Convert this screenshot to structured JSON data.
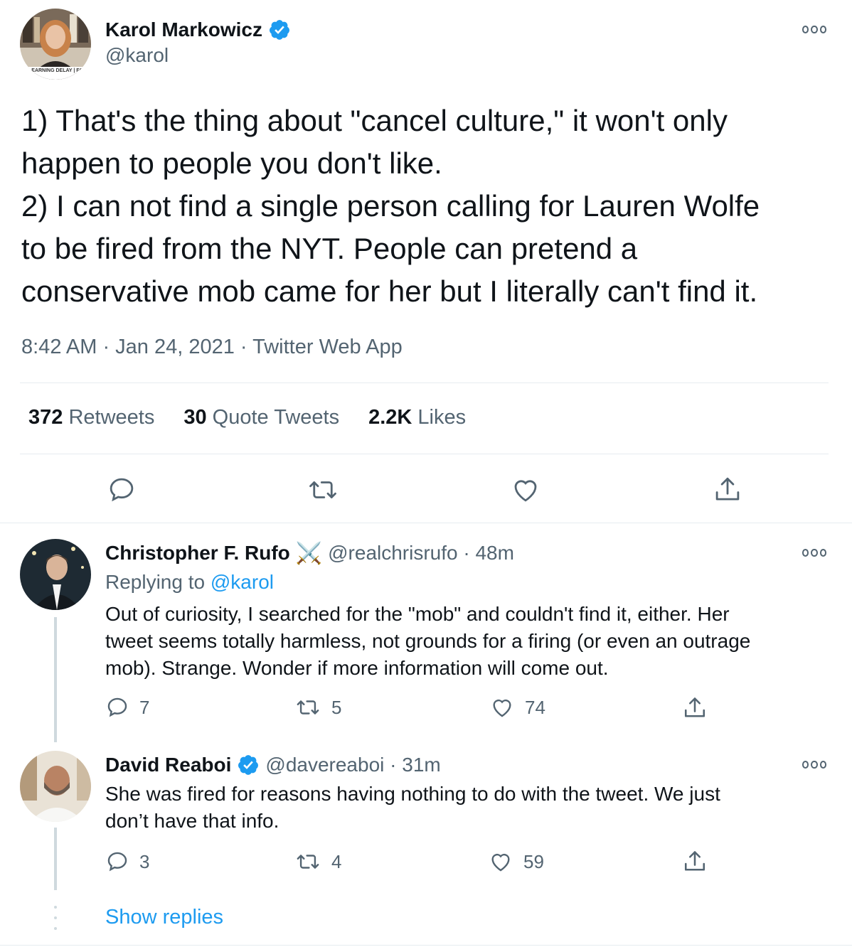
{
  "main_tweet": {
    "author_name": "Karol Markowicz",
    "handle": "@karol",
    "avatar_caption": "LEARNING DELAY | FO",
    "text_lines": [
      "1) That's the thing about \"cancel culture,\" it won't only",
      "happen to people you don't like.",
      "2) I can not find a single person calling for Lauren Wolfe",
      "to be fired from the NYT. People can pretend a",
      "conservative mob came for her but I literally can't find it."
    ],
    "meta": "8:42 AM · Jan 24, 2021 · Twitter Web App",
    "stats": {
      "retweets_count": "372",
      "retweets_label": "Retweets",
      "quotes_count": "30",
      "quotes_label": "Quote Tweets",
      "likes_count": "2.2K",
      "likes_label": "Likes"
    },
    "actions": [
      "reply",
      "retweet",
      "like",
      "share"
    ]
  },
  "replies": [
    {
      "author_name": "Christopher F. Rufo",
      "name_emoji": "⚔️",
      "handle_time": "@realchrisrufo · 48m",
      "replying_prefix": "Replying to",
      "replying_to": "@karol",
      "text_lines": [
        "Out of curiosity, I searched for the \"mob\" and couldn't find it, either. Her",
        "tweet seems totally harmless, not grounds for a firing (or even an outrage",
        "mob). Strange. Wonder if more information will come out."
      ],
      "reply_count": "7",
      "retweet_count": "5",
      "like_count": "74"
    },
    {
      "author_name": "David Reaboi",
      "handle_time": "@davereaboi · 31m",
      "text_lines": [
        "She was fired for reasons having nothing to do with the tweet. We just",
        "don’t have that info."
      ],
      "reply_count": "3",
      "retweet_count": "4",
      "like_count": "59"
    }
  ],
  "show_replies": "Show replies",
  "colors": {
    "accent": "#1d9bf0",
    "text": "#0f1419",
    "muted": "#536471",
    "divider": "#e6ecf0"
  }
}
